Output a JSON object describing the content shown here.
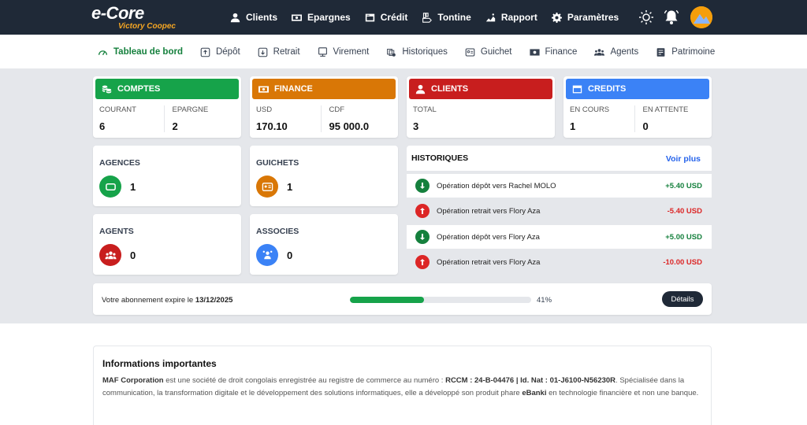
{
  "header": {
    "logo_main": "e-Core",
    "logo_sub": "Victory Coopec",
    "nav": [
      {
        "label": "Clients",
        "icon": "user-icon"
      },
      {
        "label": "Epargnes",
        "icon": "money-icon"
      },
      {
        "label": "Crédit",
        "icon": "card-icon"
      },
      {
        "label": "Tontine",
        "icon": "hand-coins-icon"
      },
      {
        "label": "Rapport",
        "icon": "chart-icon"
      },
      {
        "label": "Paramètres",
        "icon": "gear-icon"
      }
    ]
  },
  "subnav": [
    {
      "label": "Tableau de bord",
      "icon": "gauge-icon",
      "active": true
    },
    {
      "label": "Dépôt",
      "icon": "deposit-icon"
    },
    {
      "label": "Retrait",
      "icon": "withdraw-icon"
    },
    {
      "label": "Virement",
      "icon": "transfer-icon"
    },
    {
      "label": "Historiques",
      "icon": "history-icon"
    },
    {
      "label": "Guichet",
      "icon": "counter-icon"
    },
    {
      "label": "Finance",
      "icon": "finance-icon"
    },
    {
      "label": "Agents",
      "icon": "agents-icon"
    },
    {
      "label": "Patrimoine",
      "icon": "asset-icon"
    }
  ],
  "stats": {
    "comptes": {
      "title": "COMPTES",
      "color": "#16a34a",
      "c1_label": "COURANT",
      "c1_value": "6",
      "c2_label": "EPARGNE",
      "c2_value": "2"
    },
    "finance": {
      "title": "FINANCE",
      "color": "#d97706",
      "c1_label": "USD",
      "c1_value": "170.10",
      "c2_label": "CDF",
      "c2_value": "95 000.0"
    },
    "clients": {
      "title": "CLIENTS",
      "color": "#c81e1e",
      "c1_label": "TOTAL",
      "c1_value": "3"
    },
    "credits": {
      "title": "CREDITS",
      "color": "#3b82f6",
      "c1_label": "EN COURS",
      "c1_value": "1",
      "c2_label": "EN ATTENTE",
      "c2_value": "0"
    }
  },
  "mini": {
    "agences": {
      "title": "AGENCES",
      "value": "1",
      "color": "#16a34a"
    },
    "guichets": {
      "title": "GUICHETS",
      "value": "1",
      "color": "#d97706"
    },
    "agents": {
      "title": "AGENTS",
      "value": "0",
      "color": "#c81e1e"
    },
    "associes": {
      "title": "ASSOCIES",
      "value": "0",
      "color": "#3b82f6"
    }
  },
  "historiques": {
    "title": "HISTORIQUES",
    "more": "Voir plus",
    "rows": [
      {
        "text": "Opération dépôt vers Rachel MOLO",
        "amount": "+5.40 USD",
        "type": "deposit"
      },
      {
        "text": "Opération retrait vers Flory Aza",
        "amount": "-5.40 USD",
        "type": "withdraw"
      },
      {
        "text": "Opération dépôt vers Flory Aza",
        "amount": "+5.00 USD",
        "type": "deposit"
      },
      {
        "text": "Opération retrait vers Flory Aza",
        "amount": "-10.00 USD",
        "type": "withdraw"
      }
    ]
  },
  "subscription": {
    "prefix": "Votre abonnement expire le",
    "date": "13/12/2025",
    "progress_pct": 41,
    "progress_label": "41%",
    "details_label": "Détails"
  },
  "info": {
    "title": "Informations importantes",
    "company": "MAF Corporation",
    "text1": " est une société de droit congolais enregistrée au registre de commerce au numéro : ",
    "rccm": "RCCM : 24-B-04476 | Id. Nat : 01-J6100-N56230R",
    "text2": ". Spécialisée dans la communication, la transformation digitale et le développement des solutions informatiques, elle a développé son produit phare ",
    "product": "eBanki",
    "text3": " en technologie financière et non une banque."
  },
  "colors": {
    "deposit": "#15803d",
    "withdraw": "#dc2626",
    "topbar": "#1f2937",
    "accent": "#15803d"
  }
}
